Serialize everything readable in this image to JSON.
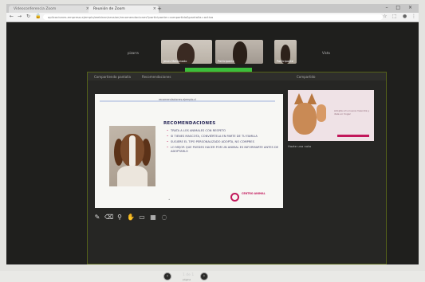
{
  "browser": {
    "tabs": [
      {
        "label": "Videoconferencia Zoom"
      },
      {
        "label": "Reunión de Zoom"
      }
    ],
    "url": "aplicaciones.empresa.ejemplo/webinar/session/recomendaciones?participante=compartido&pantalla=activa"
  },
  "conference": {
    "participants": [
      {
        "name": "Jesús Maldonado"
      },
      {
        "name": "Participante"
      },
      {
        "name": "Participante"
      }
    ],
    "left_label": "pizarra",
    "right_label": "Vista",
    "panel_tabs": [
      "Compartiendo pantalla",
      "Recomendaciones"
    ],
    "panel_right_label": "Compartido"
  },
  "slide": {
    "header_link": "recomendaciones.ejemplo.cl",
    "title": "RECOMENDACIONES",
    "items": [
      "TRATA A LOS ANIMALES CON RESPETO",
      "SI TIENES MASCOTA, CONVIÉRTELA EN PARTE DE TU FAMILIA",
      "SUGIERE EL TIPO PERSONALIZADO ADOPTA, NO COMPRES",
      "LO MEJOR QUE PUEDES HACER POR UN ANIMAL ES INFORMARTE ANTES DE ADOPTARLO"
    ],
    "logo_text": "CENTRO ANIMAL",
    "dot": "•"
  },
  "side": {
    "thumb_text": "Adopta a tu nueva mascota y dale un hogar",
    "caption": "Hazte una nota"
  },
  "pager": {
    "page": "1 de 1",
    "sub": "página"
  },
  "icons": [
    "pen-icon",
    "eraser-icon",
    "search-icon",
    "hand-icon",
    "comment-icon",
    "image-icon",
    "more-icon"
  ]
}
